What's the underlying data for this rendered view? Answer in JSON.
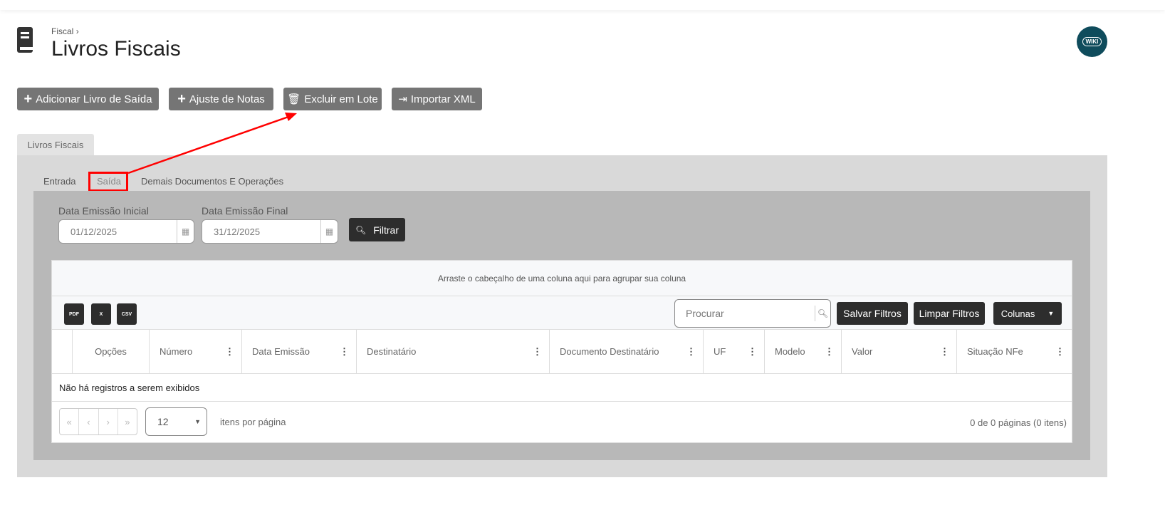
{
  "header": {
    "breadcrumb": "Fiscal",
    "breadcrumb_sep": "›",
    "title": "Livros Fiscais",
    "wiki_label": "WIKI",
    "brand_color": "#0f4c5c"
  },
  "actions": [
    {
      "label": "Adicionar Livro de Saída",
      "icon": "plus-icon"
    },
    {
      "label": "Ajuste de Notas",
      "icon": "plus-icon"
    },
    {
      "label": "Excluir em Lote",
      "icon": "trash-icon"
    },
    {
      "label": "Importar XML",
      "icon": "file-import-icon"
    }
  ],
  "main_tab": "Livros Fiscais",
  "sub_tabs": [
    {
      "label": "Entrada"
    },
    {
      "label": "Saída",
      "active": true,
      "highlighted": true
    },
    {
      "label": "Demais Documentos E Operações"
    }
  ],
  "filters": {
    "start_label": "Data Emissão Inicial",
    "start_value": "01/12/2025",
    "end_label": "Data Emissão Final",
    "end_value": "31/12/2025",
    "filter_button": "Filtrar"
  },
  "grid": {
    "group_hint": "Arraste o cabeçalho de uma coluna aqui para agrupar sua coluna",
    "exports": [
      "PDF",
      "X",
      "CSV"
    ],
    "search_placeholder": "Procurar",
    "save_filters": "Salvar Filtros",
    "clear_filters": "Limpar Filtros",
    "columns_button": "Colunas",
    "columns": [
      "Opções",
      "Número",
      "Data Emissão",
      "Destinatário",
      "Documento Destinatário",
      "UF",
      "Modelo",
      "Valor",
      "Situação NFe"
    ],
    "empty_message": "Não há registros a serem exibidos",
    "pager": {
      "page_size": "12",
      "per_page_label": "itens por página",
      "summary": "0 de 0 páginas (0 itens)",
      "buttons": [
        "«",
        "‹",
        "›",
        "»"
      ]
    }
  },
  "annotation_color": "#ff0000"
}
